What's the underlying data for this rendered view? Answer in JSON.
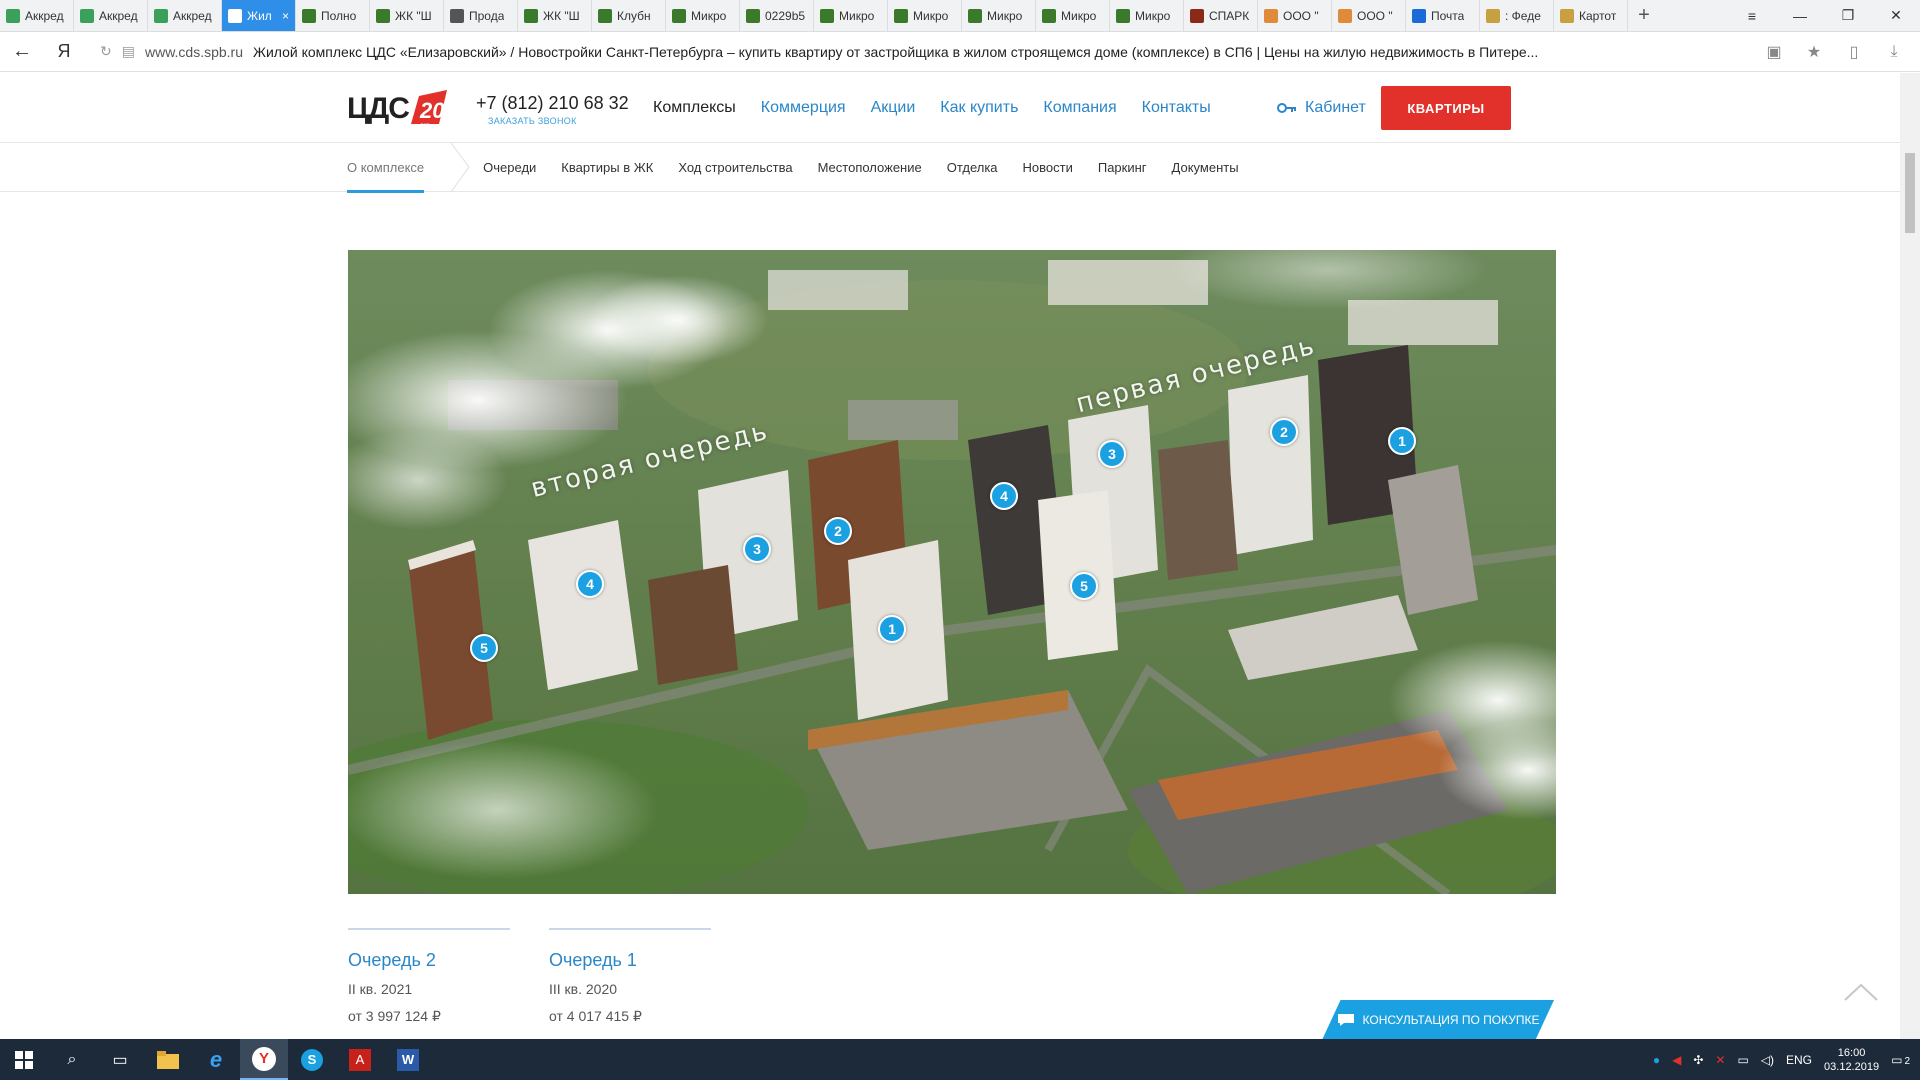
{
  "browser": {
    "tabs": [
      {
        "label": "Аккред",
        "color": "#3aa05a",
        "active": false
      },
      {
        "label": "Аккред",
        "color": "#3aa05a",
        "active": false
      },
      {
        "label": "Аккред",
        "color": "#3aa05a",
        "active": false
      },
      {
        "label": "Жил",
        "color": "#2f8fe8",
        "active": true
      },
      {
        "label": "Полно",
        "color": "#3a7a2a",
        "active": false
      },
      {
        "label": "ЖК \"Ш",
        "color": "#3a7a2a",
        "active": false
      },
      {
        "label": "Прода",
        "color": "#555555",
        "active": false
      },
      {
        "label": "ЖК \"Ш",
        "color": "#3a7a2a",
        "active": false
      },
      {
        "label": "Клубн",
        "color": "#3a7a2a",
        "active": false
      },
      {
        "label": "Микро",
        "color": "#3a7a2a",
        "active": false
      },
      {
        "label": "0229b5",
        "color": "#3a7a2a",
        "active": false
      },
      {
        "label": "Микро",
        "color": "#3a7a2a",
        "active": false
      },
      {
        "label": "Микро",
        "color": "#3a7a2a",
        "active": false
      },
      {
        "label": "Микро",
        "color": "#3a7a2a",
        "active": false
      },
      {
        "label": "Микро",
        "color": "#3a7a2a",
        "active": false
      },
      {
        "label": "Микро",
        "color": "#3a7a2a",
        "active": false
      },
      {
        "label": "СПАРК",
        "color": "#8a2a1a",
        "active": false
      },
      {
        "label": "ООО \"",
        "color": "#e08a3a",
        "active": false
      },
      {
        "label": "ООО \"",
        "color": "#e08a3a",
        "active": false
      },
      {
        "label": "Почта",
        "color": "#1a6ad8",
        "active": false
      },
      {
        "label": ": Феде",
        "color": "#c8a040",
        "active": false
      },
      {
        "label": "Картот",
        "color": "#c8a040",
        "active": false
      }
    ],
    "active_tab_close": "×",
    "new_tab": "+",
    "url_host": "www.cds.spb.ru",
    "url_title": "Жилой комплекс ЦДС «Елизаровский» / Новостройки Санкт-Петербурга – купить квартиру от застройщика в жилом строящемся доме (комплексе) в СП6 | Цены на жилую недвижимость в Питере..."
  },
  "header": {
    "logo_text": "ЦДС",
    "logo_badge": "20",
    "logo_badge_sub": "лет",
    "phone": "+7 (812) 210 68 32",
    "callback": "ЗАКАЗАТЬ ЗВОНОК",
    "nav": [
      "Комплексы",
      "Коммерция",
      "Акции",
      "Как купить",
      "Компания",
      "Контакты"
    ],
    "cabinet": "Кабинет",
    "apartments_button": "КВАРТИРЫ",
    "accent_color": "#e2302a",
    "link_color": "#2b86c8"
  },
  "subnav": {
    "items": [
      "О комплексе",
      "Очереди",
      "Квартиры в ЖК",
      "Ход строительства",
      "Местоположение",
      "Отделка",
      "Новости",
      "Паркинг",
      "Документы"
    ]
  },
  "hero": {
    "label_second": "вторая очередь",
    "label_first": "первая очередь",
    "markers_second": [
      "5",
      "4",
      "3",
      "2",
      "1"
    ],
    "markers_first": [
      "4",
      "3",
      "2",
      "1",
      "5"
    ]
  },
  "queues": [
    {
      "title": "Очередь 2",
      "date": "II кв. 2021",
      "price": "от 3 997 124 ₽"
    },
    {
      "title": "Очередь 1",
      "date": "III кв. 2020",
      "price": "от 4 017 415 ₽"
    }
  ],
  "consult_button": "КОНСУЛЬТАЦИЯ ПО ПОКУПКЕ",
  "taskbar": {
    "lang": "ENG",
    "time": "16:00",
    "date": "03.12.2019",
    "notifications": "2"
  }
}
